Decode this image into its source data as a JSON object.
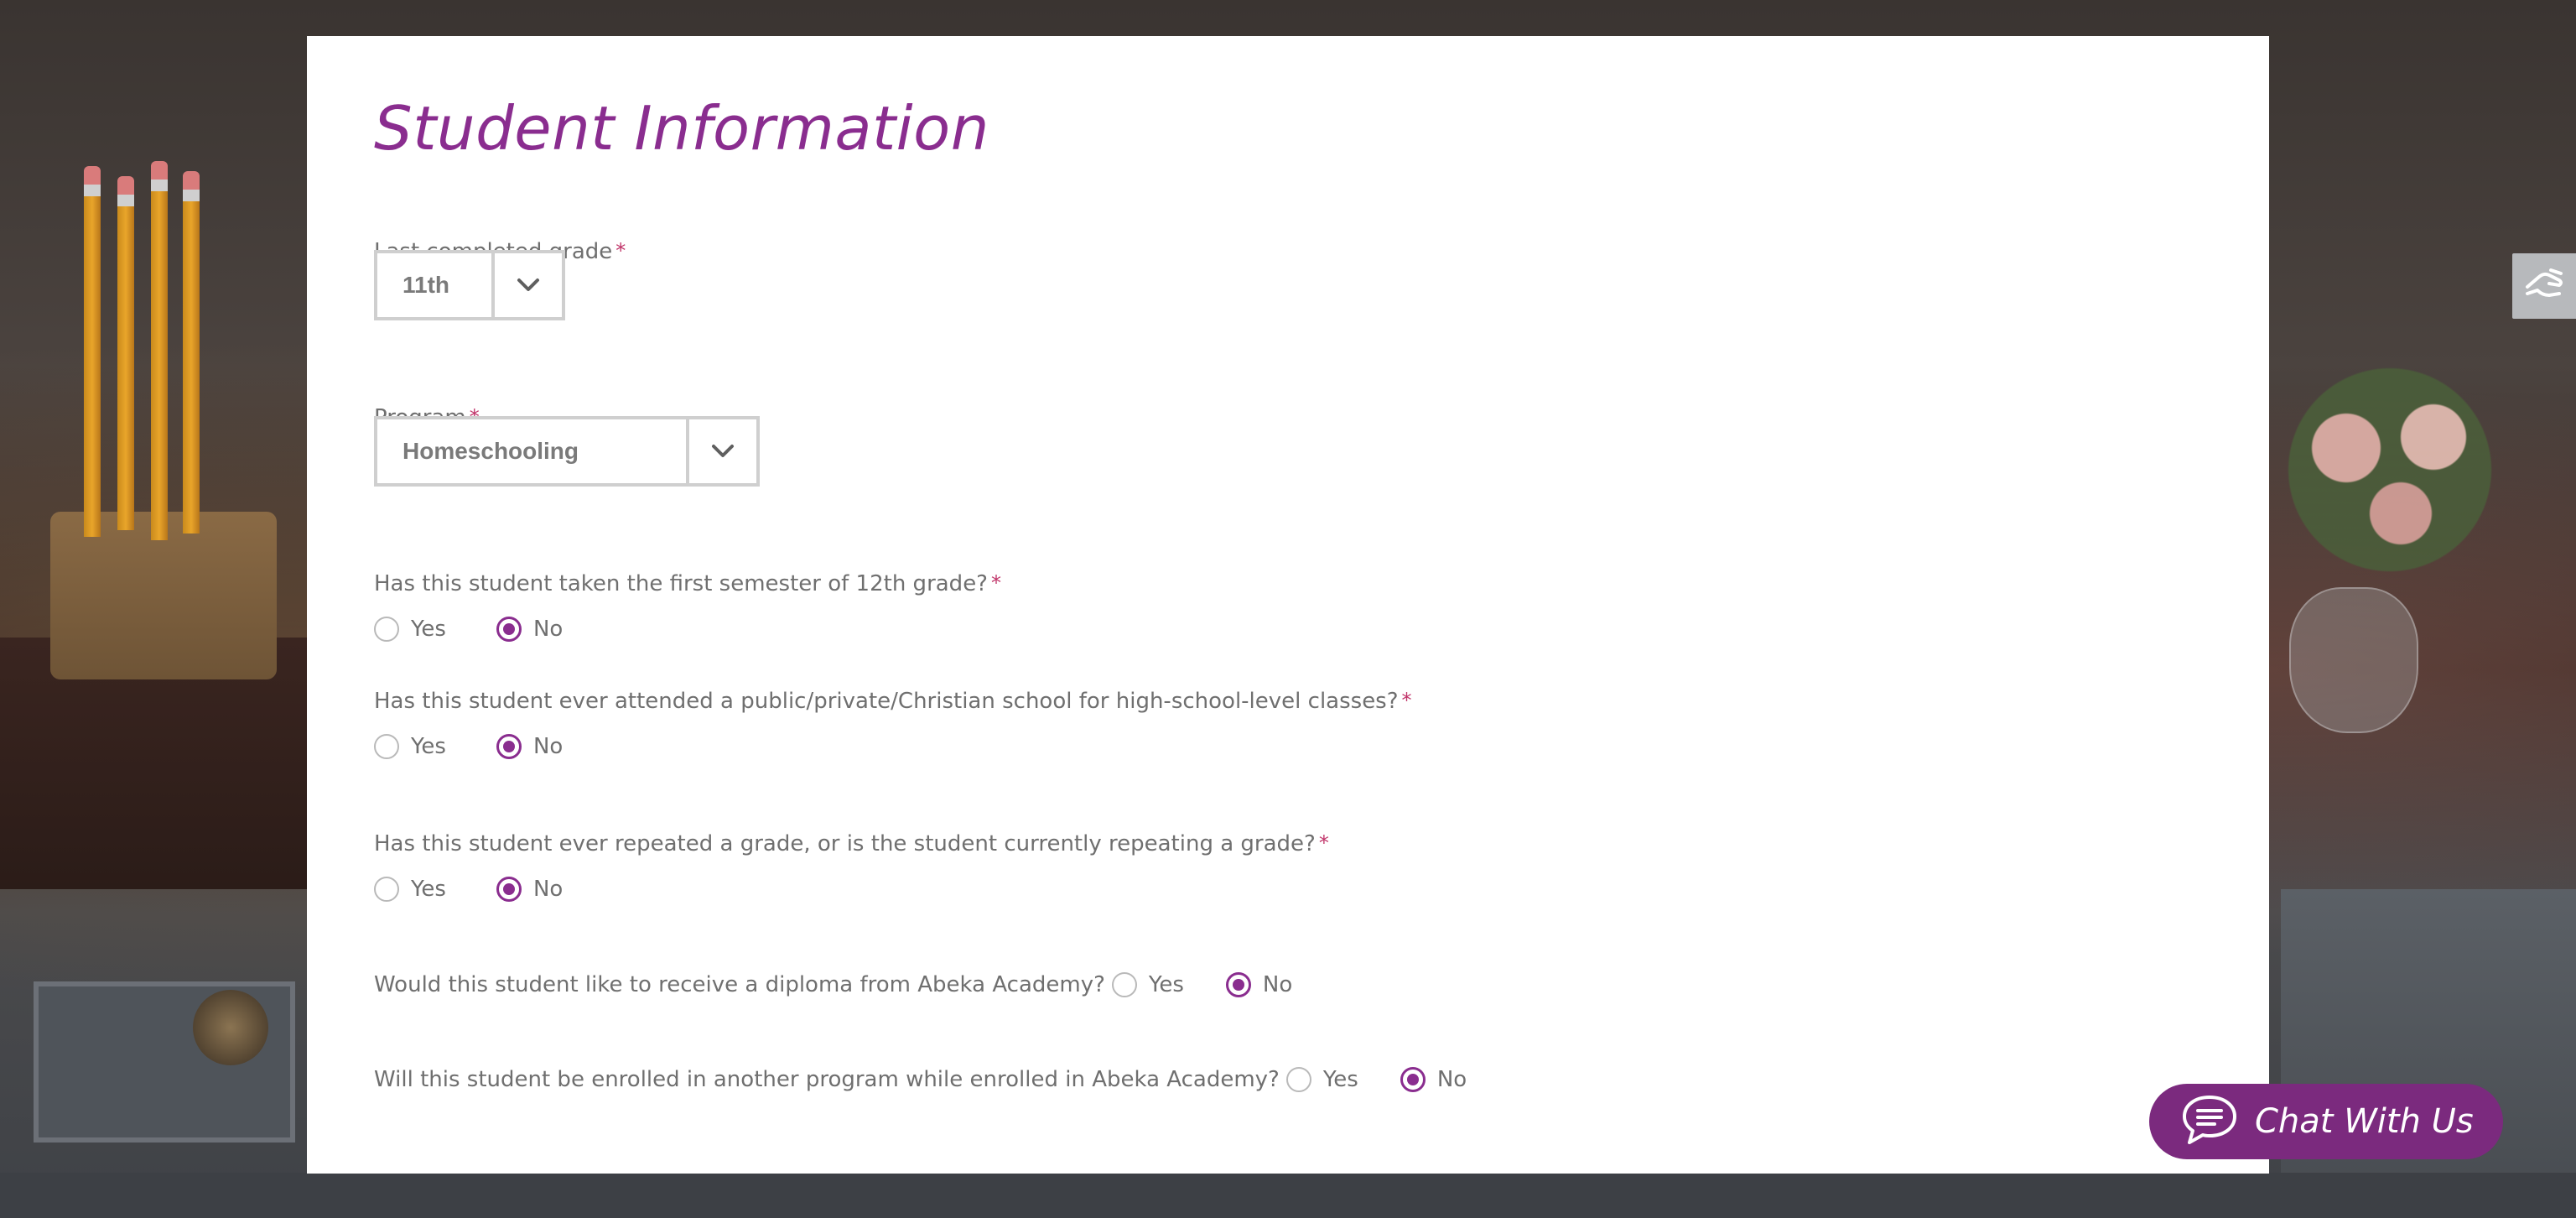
{
  "form": {
    "title": "Student Information",
    "grade": {
      "label": "Last completed grade",
      "required_mark": "*",
      "value": "11th"
    },
    "program": {
      "label": "Program",
      "required_mark": "*",
      "value": "Homeschooling"
    },
    "questions": [
      {
        "label": "Has this student taken the first semester of 12th grade?",
        "required_mark": "*",
        "yes_label": "Yes",
        "no_label": "No",
        "selected": "No"
      },
      {
        "label": "Has this student ever attended a public/private/Christian school for high-school-level classes?",
        "required_mark": "*",
        "yes_label": "Yes",
        "no_label": "No",
        "selected": "No"
      },
      {
        "label": "Has this student ever repeated a grade, or is the student currently repeating a grade?",
        "required_mark": "*",
        "yes_label": "Yes",
        "no_label": "No",
        "selected": "No"
      },
      {
        "label": "Would this student like to receive a diploma from Abeka Academy?",
        "yes_label": "Yes",
        "no_label": "No",
        "selected": "No"
      },
      {
        "label": "Will this student be enrolled in another program while enrolled in Abeka Academy?",
        "yes_label": "Yes",
        "no_label": "No",
        "selected": "No"
      }
    ]
  },
  "chat": {
    "label": "Chat With Us",
    "icon": "chat-bubble-icon"
  },
  "accessibility_tab": {
    "icon": "accessibility-hand-icon"
  },
  "colors": {
    "accent": "#8a2d8f",
    "chat_button": "#7b2a7e",
    "required": "#c1356a",
    "label_text": "#6f6f6f"
  }
}
